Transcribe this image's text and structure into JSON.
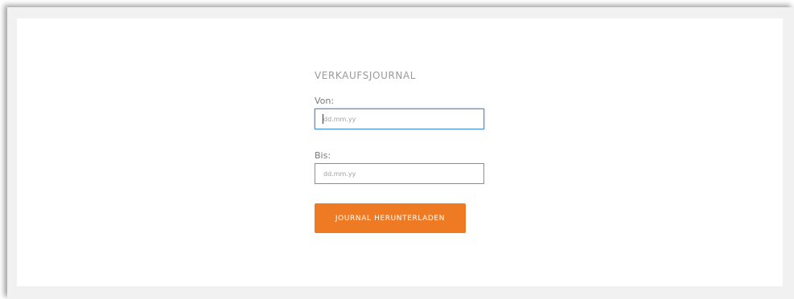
{
  "form": {
    "title": "VERKAUFSJOURNAL",
    "von_label": "Von:",
    "von_placeholder": "dd.mm.yy",
    "bis_label": "Bis:",
    "bis_placeholder": "dd.mm.yy",
    "download_button": "JOURNAL HERUNTERLADEN"
  },
  "colors": {
    "accent": "#ef7a24",
    "focus_border": "#4a90d9"
  }
}
